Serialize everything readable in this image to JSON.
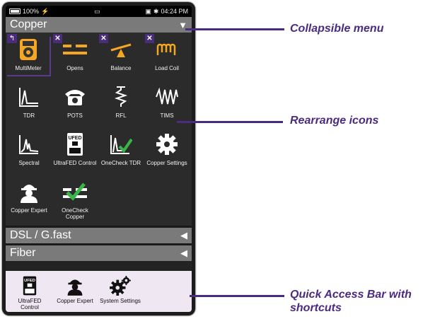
{
  "status": {
    "battery": "100%",
    "time": "04:24 PM"
  },
  "sections": {
    "copper": {
      "label": "Copper",
      "state": "expanded"
    },
    "dsl": {
      "label": "DSL / G.fast",
      "state": "collapsed"
    },
    "fiber": {
      "label": "Fiber",
      "state": "collapsed"
    }
  },
  "copper_apps": [
    {
      "label": "MultiMeter",
      "icon": "multimeter-icon"
    },
    {
      "label": "Opens",
      "icon": "opens-icon"
    },
    {
      "label": "Balance",
      "icon": "balance-icon"
    },
    {
      "label": "Load Coil",
      "icon": "load-coil-icon"
    },
    {
      "label": "TDR",
      "icon": "tdr-icon"
    },
    {
      "label": "POTS",
      "icon": "telephone-icon"
    },
    {
      "label": "RFL",
      "icon": "rfl-icon"
    },
    {
      "label": "TIMS",
      "icon": "tims-icon"
    },
    {
      "label": "Spectral",
      "icon": "spectral-icon"
    },
    {
      "label": "UltraFED Control",
      "icon": "ultrafed-icon"
    },
    {
      "label": "OneCheck TDR",
      "icon": "onecheck-tdr-icon"
    },
    {
      "label": "Copper Settings",
      "icon": "gear-icon"
    },
    {
      "label": "Copper Expert",
      "icon": "technician-icon"
    },
    {
      "label": "OneCheck Copper",
      "icon": "onecheck-copper-icon"
    }
  ],
  "quick_access": [
    {
      "label": "UltraFED Control",
      "icon": "ultrafed-icon"
    },
    {
      "label": "Copper Expert",
      "icon": "technician-icon"
    },
    {
      "label": "System Settings",
      "icon": "gears-icon"
    }
  ],
  "callouts": {
    "collapsible": "Collapsible menu",
    "rearrange": "Rearrange icons",
    "quick_access": "Quick Access Bar with shortcuts"
  },
  "colors": {
    "accent": "#4b2a82",
    "icon_orange": "#f5a623",
    "check_green": "#39b54a"
  }
}
